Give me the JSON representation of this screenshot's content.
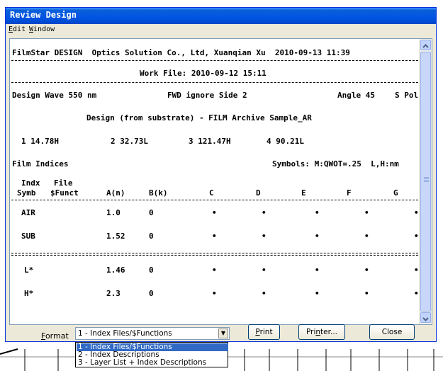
{
  "window": {
    "title": "Review Design"
  },
  "menu": [
    {
      "accel": "E",
      "rest": "dit"
    },
    {
      "accel": "W",
      "rest": "indow"
    }
  ],
  "report": {
    "header": "FilmStar DESIGN  Optics Solution Co., Ltd, Xuanqian Xu  2010-09-13 11:39",
    "work_file": "Work File: 2010-09-12 15:11",
    "design_wave": "Design Wave 550 nm",
    "fwd": "FWD ignore Side 2",
    "angle": "Angle 45",
    "pol": "S Pol",
    "design_line": "Design (from substrate) - FILM Archive Sample_AR",
    "layers": [
      "1 14.78H",
      "2 32.73L",
      "3 121.47H",
      "4 90.21L"
    ],
    "film_indices": "Film Indices",
    "symbols": "Symbols: M:QWOT=.25  L,H:nm",
    "columns_row1": [
      "Indx",
      "File"
    ],
    "columns_row2": [
      "Symb",
      "$Funct",
      "A(n)",
      "B(k)",
      "C",
      "D",
      "E",
      "F",
      "G"
    ],
    "rows": [
      {
        "symb": "AIR",
        "an": "1.0",
        "bk": "0",
        "dots": [
          "•",
          "•",
          "•",
          "•",
          "•"
        ]
      },
      {
        "symb": "SUB",
        "an": "1.52",
        "bk": "0",
        "dots": [
          "•",
          "•",
          "•",
          "•",
          "•"
        ]
      },
      {
        "symb": "L*",
        "an": "1.46",
        "bk": "0",
        "dots": [
          "•",
          "•",
          "•",
          "•",
          "•"
        ]
      },
      {
        "symb": "H*",
        "an": "2.3",
        "bk": "0",
        "dots": [
          "•",
          "•",
          "•",
          "•",
          "•"
        ]
      }
    ]
  },
  "format": {
    "label_accel": "F",
    "label_rest": "ormat",
    "selected": "1 - Index Files/$Functions",
    "options": [
      "1 - Index Files/$Functions",
      "2 - Index Descriptions",
      "3 - Layer List + Index Descriptions"
    ]
  },
  "buttons": {
    "print_accel": "P",
    "print_rest": "rint",
    "printer_pre": "Pri",
    "printer_accel": "n",
    "printer_rest": "ter...",
    "close": "Close"
  }
}
